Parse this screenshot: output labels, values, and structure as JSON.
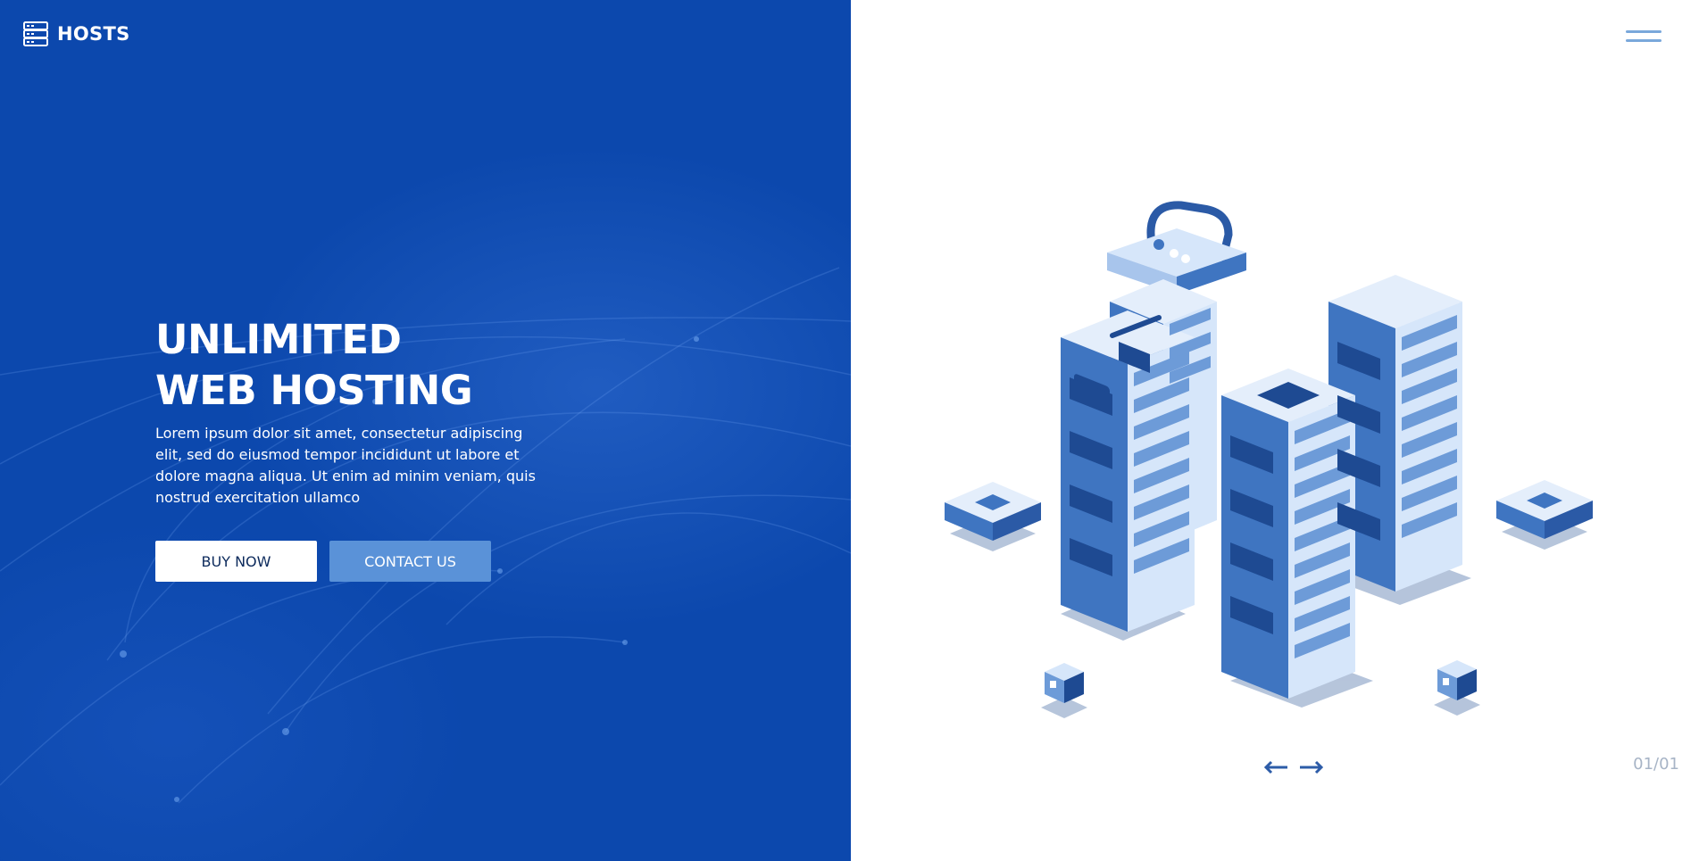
{
  "brand": {
    "name": "HOSTS",
    "icon": "server-stack-icon"
  },
  "hero": {
    "title_line1": "UNLIMITED",
    "title_line2": "WEB HOSTING",
    "description": "Lorem ipsum dolor sit amet, consectetur adipiscing elit, sed do eiusmod tempor incididunt ut labore et dolore magna aliqua. Ut enim ad minim veniam, quis nostrud exercitation ullamco",
    "buy_label": "BUY NOW",
    "contact_label": "CONTACT US"
  },
  "header": {
    "menu_icon": "hamburger-menu-icon"
  },
  "slider": {
    "counter": "01/01",
    "prev_icon": "arrow-left-icon",
    "next_icon": "arrow-right-icon"
  },
  "colors": {
    "primary_blue": "#0c48ad",
    "accent_blue": "#5a92d8",
    "server_dark": "#2d5ca8",
    "server_light": "#d6e6fa",
    "counter_gray": "#a7b4c6"
  }
}
